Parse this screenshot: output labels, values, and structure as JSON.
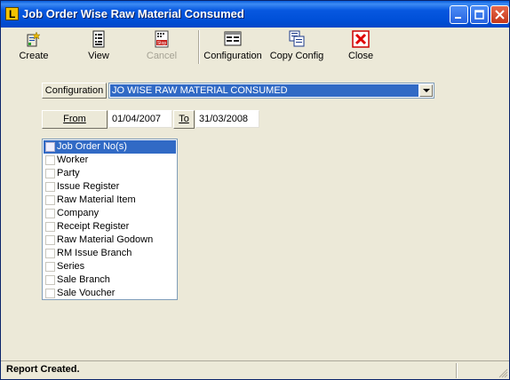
{
  "window": {
    "title": "Job Order Wise Raw Material Consumed",
    "title_bar_color": "#0054e3"
  },
  "toolbar": {
    "items": [
      {
        "label": "Create",
        "icon": "create-icon",
        "enabled": true
      },
      {
        "label": "View",
        "icon": "view-icon",
        "enabled": true
      },
      {
        "label": "Cancel",
        "icon": "stop-icon",
        "enabled": false
      },
      {
        "label": "Configuration",
        "icon": "configuration-icon",
        "enabled": true
      },
      {
        "label": "Copy Config",
        "icon": "copy-config-icon",
        "enabled": true
      },
      {
        "label": "Close",
        "icon": "close-x-icon",
        "enabled": true
      }
    ]
  },
  "form": {
    "configuration_label": "Configuration",
    "configuration_value": "JO WISE RAW MATERIAL CONSUMED",
    "from_label": "From",
    "from_date": "01/04/2007",
    "to_label": "To",
    "to_date": "31/03/2008"
  },
  "filters": {
    "selected_index": 0,
    "items": [
      {
        "label": "Job Order No(s)",
        "checked": false
      },
      {
        "label": "Worker",
        "checked": false
      },
      {
        "label": "Party",
        "checked": false
      },
      {
        "label": "Issue Register",
        "checked": false
      },
      {
        "label": "Raw Material Item",
        "checked": false
      },
      {
        "label": "Company",
        "checked": false
      },
      {
        "label": "Receipt Register",
        "checked": false
      },
      {
        "label": "Raw Material Godown",
        "checked": false
      },
      {
        "label": "RM Issue Branch",
        "checked": false
      },
      {
        "label": "Series",
        "checked": false
      },
      {
        "label": "Sale Branch",
        "checked": false
      },
      {
        "label": "Sale Voucher",
        "checked": false
      }
    ]
  },
  "status": {
    "text": "Report Created."
  }
}
